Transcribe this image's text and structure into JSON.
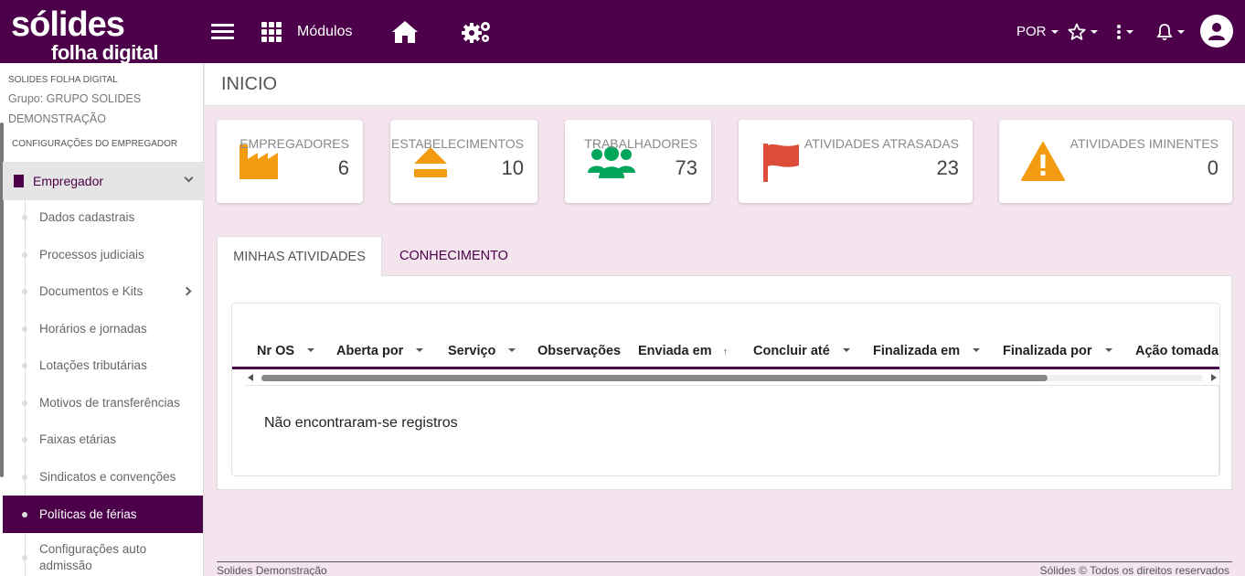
{
  "topbar": {
    "logo_line1": "sólides",
    "logo_line2": "folha digital",
    "modules_label": "Módulos",
    "language": "POR"
  },
  "sidebar": {
    "org_name": "SOLIDES FOLHA DIGITAL",
    "group_text": "Grupo: GRUPO SOLIDES DEMONSTRAÇÃO",
    "config_title": "CONFIGURAÇÕES DO EMPREGADOR",
    "section_label": "Empregador",
    "items": [
      {
        "label": "Dados cadastrais"
      },
      {
        "label": "Processos judiciais"
      },
      {
        "label": "Documentos e Kits"
      },
      {
        "label": "Horários e jornadas"
      },
      {
        "label": "Lotações tributárias"
      },
      {
        "label": "Motivos de transferências"
      },
      {
        "label": "Faixas etárias"
      },
      {
        "label": "Sindicatos e convenções"
      },
      {
        "label": "Políticas de férias"
      },
      {
        "label": "Configurações auto admissão"
      }
    ]
  },
  "page": {
    "title": "INICIO"
  },
  "cards": [
    {
      "label": "EMPREGADORES",
      "value": "6",
      "icon": "factory-icon",
      "color": "#f39c12"
    },
    {
      "label": "ESTABELECIMENTOS",
      "value": "10",
      "icon": "eject-icon",
      "color": "#f39c12"
    },
    {
      "label": "TRABALHADORES",
      "value": "73",
      "icon": "users-icon",
      "color": "#00a65a"
    },
    {
      "label": "ATIVIDADES ATRASADAS",
      "value": "23",
      "icon": "flag-icon",
      "color": "#dd4b39"
    },
    {
      "label": "ATIVIDADES IMINENTES",
      "value": "0",
      "icon": "warning-icon",
      "color": "#f39c12"
    }
  ],
  "tabs": {
    "active": "MINHAS ATIVIDADES",
    "inactive": "CONHECIMENTO"
  },
  "table": {
    "columns": [
      "Nr OS",
      "Aberta por",
      "Serviço",
      "Observações",
      "Enviada em",
      "Concluir até",
      "Finalizada em",
      "Finalizada por",
      "Ação tomada"
    ],
    "empty_message": "Não encontraram-se registros"
  },
  "footer": {
    "left": "Solides Demonstração",
    "right": "Sólides © Todos os direitos reservados"
  },
  "colors": {
    "brand": "#4b0049",
    "background": "#f3e4ee"
  }
}
